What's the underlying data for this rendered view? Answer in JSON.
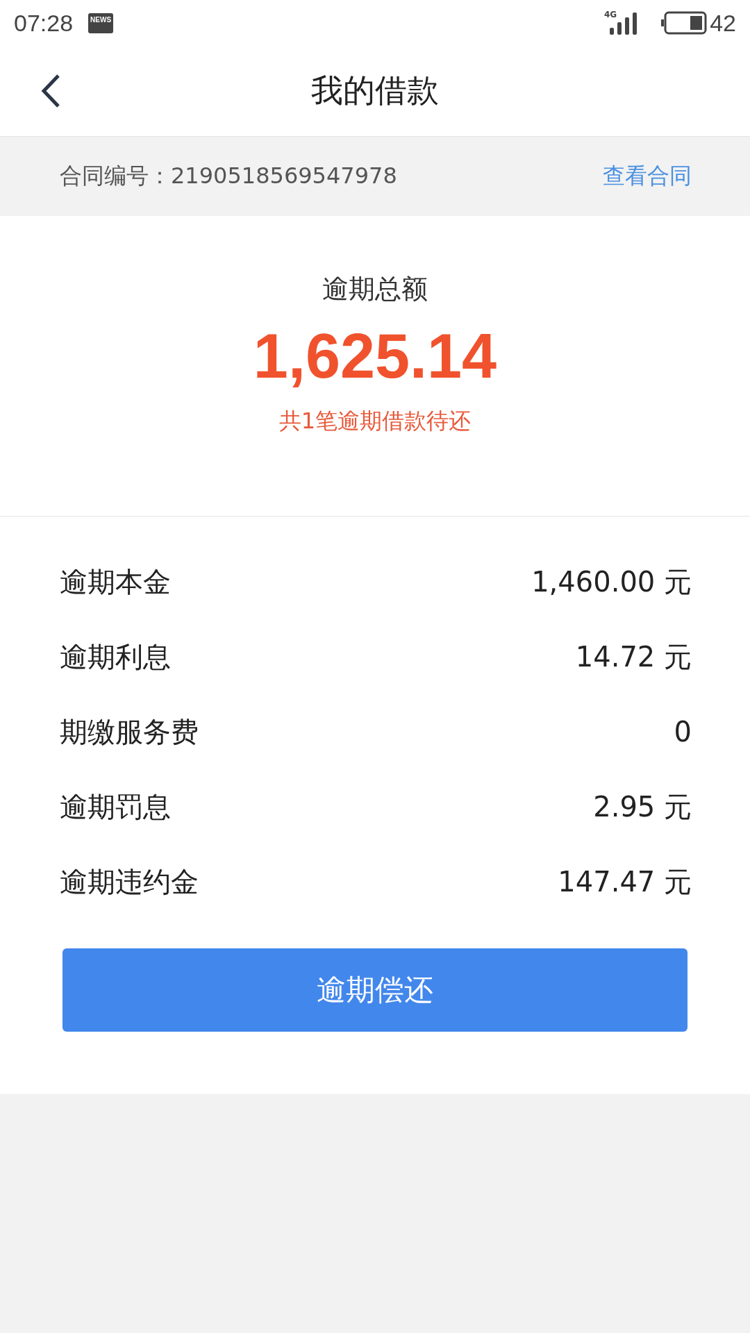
{
  "status_bar": {
    "time": "07:28",
    "notification": "NEWS",
    "network": "4G",
    "battery": "42"
  },
  "header": {
    "title": "我的借款"
  },
  "contract": {
    "label": "合同编号：2190518569547978",
    "link": "查看合同"
  },
  "overdue": {
    "title": "逾期总额",
    "amount": "1,625.14",
    "note": "共1笔逾期借款待还"
  },
  "details": [
    {
      "label": "逾期本金",
      "value": "1,460.00 元"
    },
    {
      "label": "逾期利息",
      "value": "14.72 元"
    },
    {
      "label": "期缴服务费",
      "value": "0"
    },
    {
      "label": "逾期罚息",
      "value": "2.95 元"
    },
    {
      "label": "逾期违约金",
      "value": "147.47 元"
    }
  ],
  "button": "逾期偿还"
}
